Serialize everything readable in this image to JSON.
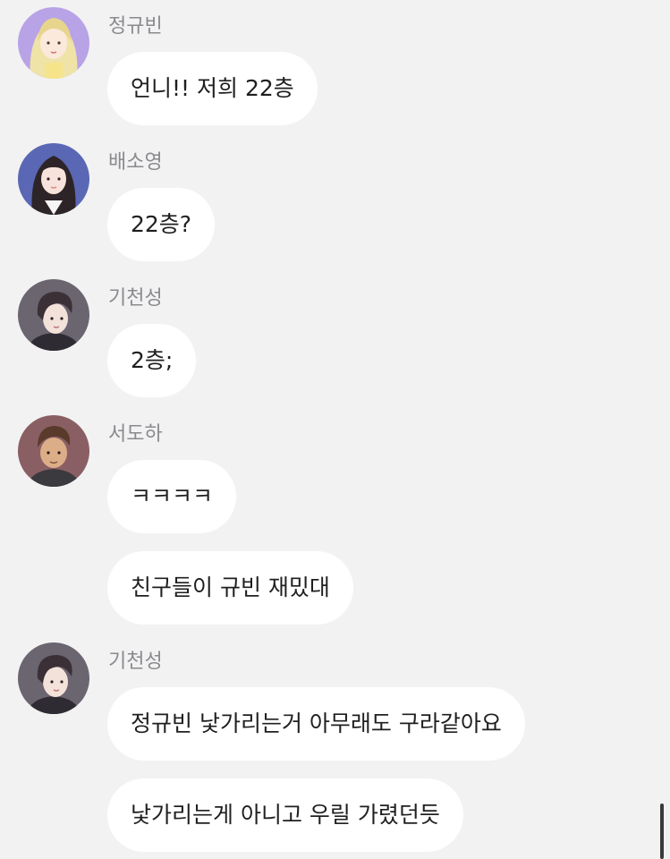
{
  "messages": [
    {
      "sender": "정규빈",
      "avatar": "avatar-gyubin",
      "text": "언니!! 저희 22층"
    },
    {
      "sender": "배소영",
      "avatar": "avatar-soyoung",
      "text": "22층?"
    },
    {
      "sender": "기천성",
      "avatar": "avatar-cheonseong",
      "text": "2층;"
    },
    {
      "sender": "서도하",
      "avatar": "avatar-doha",
      "text": "ㅋㅋㅋㅋ"
    },
    {
      "text": "친구들이 규빈 재밌대"
    },
    {
      "sender": "기천성",
      "avatar": "avatar-cheonseong",
      "text": "정규빈 낯가리는거 아무래도 구라같아요"
    },
    {
      "text": "낯가리는게 아니고 우릴 가렸던듯"
    }
  ],
  "colors": {
    "background": "#f2f2f3",
    "bubble": "#ffffff",
    "sender_text": "#8a8a8e",
    "message_text": "#1f1f1f"
  }
}
